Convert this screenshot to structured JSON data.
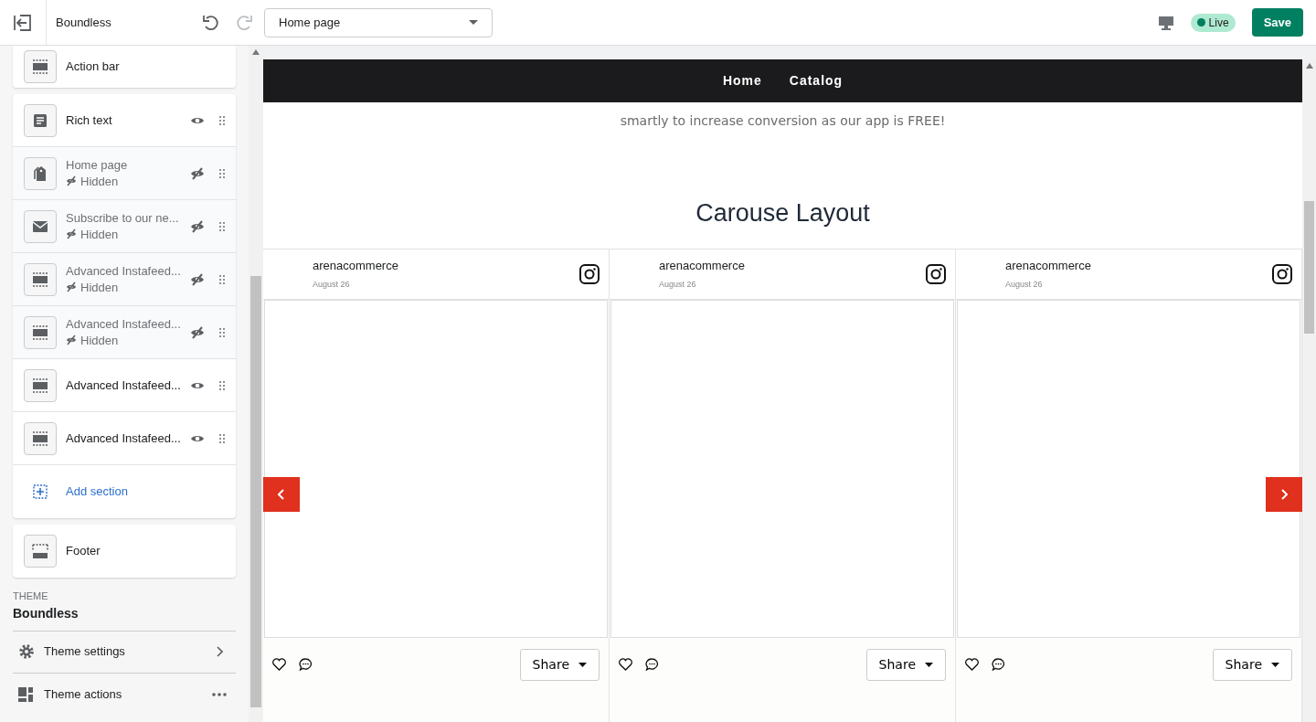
{
  "topbar": {
    "theme_name": "Boundless",
    "page_select": "Home page",
    "live_badge": "Live",
    "save_button": "Save"
  },
  "header_section": {
    "title": "Action bar",
    "kind": "section"
  },
  "sections": [
    {
      "title": "Rich text",
      "kind": "text",
      "hidden": false
    },
    {
      "title": "Home page",
      "kind": "tag",
      "hidden": true,
      "hidden_label": "Hidden"
    },
    {
      "title": "Subscribe to our ne...",
      "kind": "mail",
      "hidden": true,
      "hidden_label": "Hidden"
    },
    {
      "title": "Advanced Instafeed...",
      "kind": "section",
      "hidden": true,
      "hidden_label": "Hidden"
    },
    {
      "title": "Advanced Instafeed...",
      "kind": "section",
      "hidden": true,
      "hidden_label": "Hidden"
    },
    {
      "title": "Advanced Instafeed...",
      "kind": "section",
      "hidden": false
    },
    {
      "title": "Advanced Instafeed...",
      "kind": "section",
      "hidden": false
    }
  ],
  "add_section": "Add section",
  "footer_section": {
    "title": "Footer",
    "kind": "footer"
  },
  "theme": {
    "label": "THEME",
    "name": "Boundless",
    "items": [
      {
        "label": "Theme settings",
        "kind": "settings"
      },
      {
        "label": "Theme actions",
        "kind": "actions"
      }
    ]
  },
  "preview": {
    "nav": [
      "Home",
      "Catalog"
    ],
    "intro": "smartly to increase conversion as our app is FREE!",
    "heading": "Carouse Layout",
    "posts": [
      {
        "user": "arenacommerce",
        "date": "August 26",
        "share": "Share"
      },
      {
        "user": "arenacommerce",
        "date": "August 26",
        "share": "Share"
      },
      {
        "user": "arenacommerce",
        "date": "August 26",
        "share": "Share"
      }
    ]
  }
}
